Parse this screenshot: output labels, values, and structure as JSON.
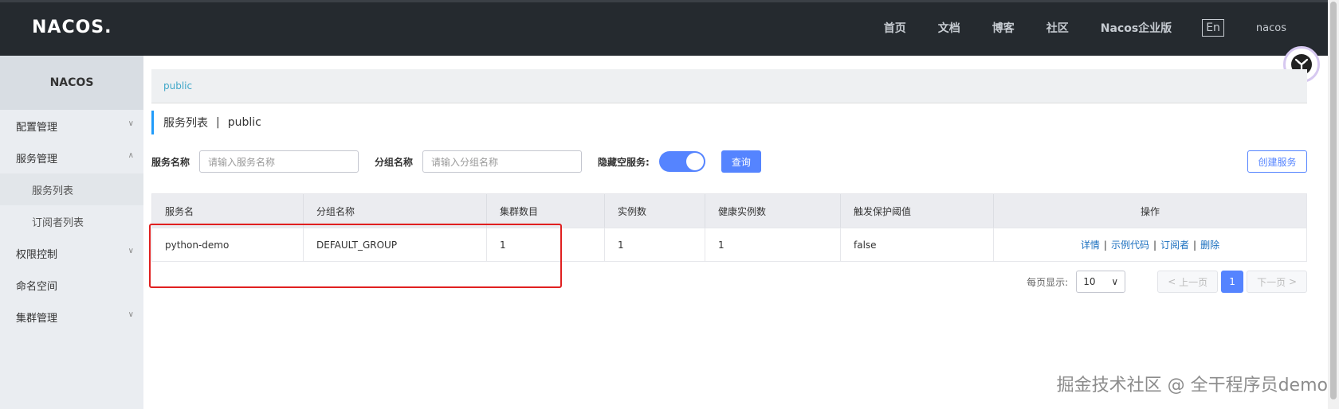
{
  "header": {
    "logo": "NACOS.",
    "nav": [
      "首页",
      "文档",
      "博客",
      "社区",
      "Nacos企业版"
    ],
    "lang": "En",
    "user": "nacos"
  },
  "sidebar": {
    "title": "NACOS",
    "items": [
      {
        "label": "配置管理",
        "expanded": false
      },
      {
        "label": "服务管理",
        "expanded": true
      },
      {
        "label": "服务列表",
        "sub": true,
        "active": true
      },
      {
        "label": "订阅者列表",
        "sub": true
      },
      {
        "label": "权限控制",
        "expanded": false
      },
      {
        "label": "命名空间"
      },
      {
        "label": "集群管理",
        "expanded": false
      }
    ]
  },
  "breadcrumb": "public",
  "page_title": {
    "main": "服务列表",
    "sep": "|",
    "namespace": "public"
  },
  "filters": {
    "service_label": "服务名称",
    "service_placeholder": "请输入服务名称",
    "group_label": "分组名称",
    "group_placeholder": "请输入分组名称",
    "hide_empty_label": "隐藏空服务:",
    "hide_empty_on": true,
    "query_button": "查询",
    "create_button": "创建服务"
  },
  "table": {
    "headers": [
      "服务名",
      "分组名称",
      "集群数目",
      "实例数",
      "健康实例数",
      "触发保护阈值",
      "操作"
    ],
    "rows": [
      {
        "name": "python-demo",
        "group": "DEFAULT_GROUP",
        "clusters": "1",
        "instances": "1",
        "healthy": "1",
        "protect": "false"
      }
    ],
    "ops": [
      "详情",
      "示例代码",
      "订阅者",
      "删除"
    ]
  },
  "pagination": {
    "per_page_label": "每页显示:",
    "per_page": "10",
    "prev": "上一页",
    "current": "1",
    "next": "下一页"
  },
  "watermark": "掘金技术社区 @ 全干程序员demo",
  "colors": {
    "primary": "#5584ff",
    "topbar": "#252a2f",
    "highlight": "#e02020"
  }
}
